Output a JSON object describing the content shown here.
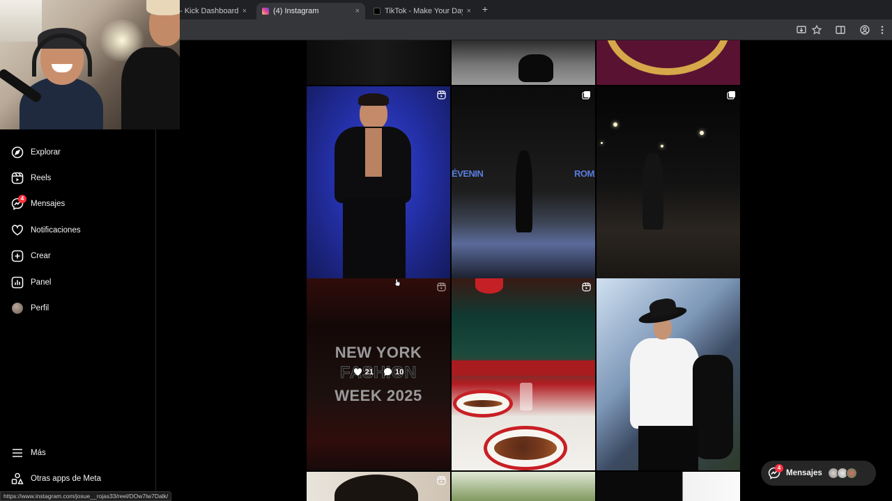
{
  "browser": {
    "tabs": [
      {
        "title": "- Kick Dashboard",
        "active": false,
        "favicon_color": "#53fc18"
      },
      {
        "title": "(4) Instagram",
        "active": true,
        "favicon_color": "#e1306c"
      },
      {
        "title": "TikTok - Make Your Day",
        "active": false,
        "favicon_color": "#ffffff"
      }
    ],
    "new_tab_label": "+",
    "close_glyph": "×",
    "status_url": "https://www.instagram.com/josue__rojas33/reel/DOw7lw7Dalk/"
  },
  "sidebar": {
    "items": [
      {
        "label": "Explorar",
        "icon": "compass-icon"
      },
      {
        "label": "Reels",
        "icon": "reels-icon"
      },
      {
        "label": "Mensajes",
        "icon": "messenger-icon",
        "badge": "4"
      },
      {
        "label": "Notificaciones",
        "icon": "heart-icon"
      },
      {
        "label": "Crear",
        "icon": "plus-square-icon"
      },
      {
        "label": "Panel",
        "icon": "bar-chart-icon"
      },
      {
        "label": "Perfil",
        "icon": "avatar"
      }
    ],
    "bottom": [
      {
        "label": "Más",
        "icon": "menu-icon"
      },
      {
        "label": "Otras apps de Meta",
        "icon": "apps-icon"
      }
    ]
  },
  "grid": {
    "hover_post": {
      "likes": "21",
      "comments": "10",
      "text_lines": [
        "NEW YORK",
        "FASHION",
        "WEEK 2025"
      ]
    },
    "runway_banner_left": "ÉVENIN",
    "runway_banner_right": "ROMAI"
  },
  "messages_pill": {
    "label": "Mensajes",
    "badge": "4",
    "more": "···"
  },
  "colors": {
    "accent_badge": "#ff3040",
    "bg": "#000000",
    "pill_bg": "#262626"
  }
}
